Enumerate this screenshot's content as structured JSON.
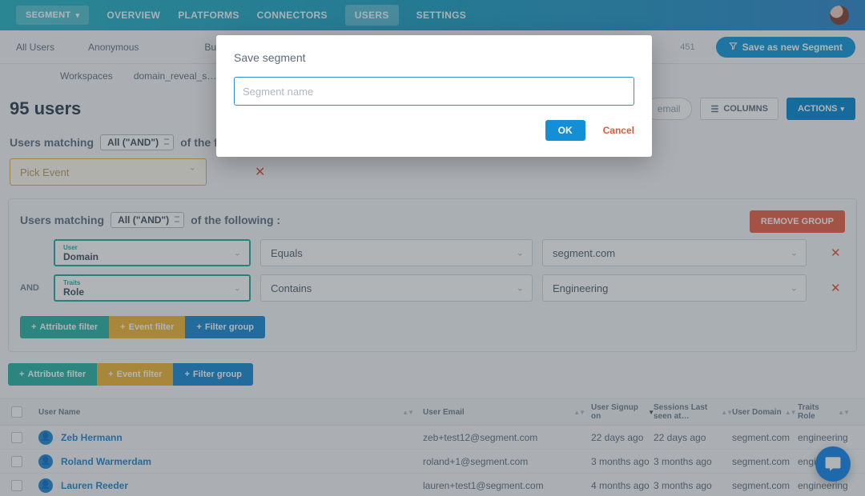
{
  "nav": {
    "segment_label": "SEGMENT",
    "items": [
      "OVERVIEW",
      "PLATFORMS",
      "CONNECTORS",
      "USERS",
      "SETTINGS"
    ],
    "active_index": 3
  },
  "segments_bar": {
    "items_row1": [
      "All Users",
      "Anonymous",
      "Business Tier Us…"
    ],
    "items_row2": [
      "Workspaces",
      "domain_reveal_s…"
    ],
    "count_label": "451",
    "save_button": "Save as new Segment"
  },
  "page_title": "95 users",
  "head_controls": {
    "search_placeholder": "email",
    "columns_label": "COLUMNS",
    "actions_label": "ACTIONS"
  },
  "match_text_prefix": "Users matching",
  "match_text_suffix": "of the following",
  "match_mode": "All (\"AND\")",
  "pick_event_placeholder": "Pick Event",
  "group": {
    "remove_label": "REMOVE GROUP",
    "and_label": "AND",
    "rows": [
      {
        "trait_label": "User",
        "trait_value": "Domain",
        "operator": "Equals",
        "value": "segment.com"
      },
      {
        "trait_label": "Traits",
        "trait_value": "Role",
        "operator": "Contains",
        "value": "Engineering"
      }
    ]
  },
  "filter_buttons": {
    "attribute": "Attribute filter",
    "event": "Event filter",
    "group": "Filter group"
  },
  "table": {
    "columns": [
      "User Name",
      "User Email",
      "User Signup on",
      "Sessions Last seen at…",
      "User Domain",
      "Traits Role"
    ],
    "rows": [
      {
        "name": "Zeb Hermann",
        "email": "zeb+test12@segment.com",
        "signup": "22 days ago",
        "session": "22 days ago",
        "domain": "segment.com",
        "role": "engineering"
      },
      {
        "name": "Roland Warmerdam",
        "email": "roland+1@segment.com",
        "signup": "3 months ago",
        "session": "3 months ago",
        "domain": "segment.com",
        "role": "engineering"
      },
      {
        "name": "Lauren Reeder",
        "email": "lauren+test1@segment.com",
        "signup": "4 months ago",
        "session": "3 months ago",
        "domain": "segment.com",
        "role": "engineering"
      }
    ]
  },
  "modal": {
    "title": "Save segment",
    "placeholder": "Segment name",
    "ok": "OK",
    "cancel": "Cancel"
  }
}
